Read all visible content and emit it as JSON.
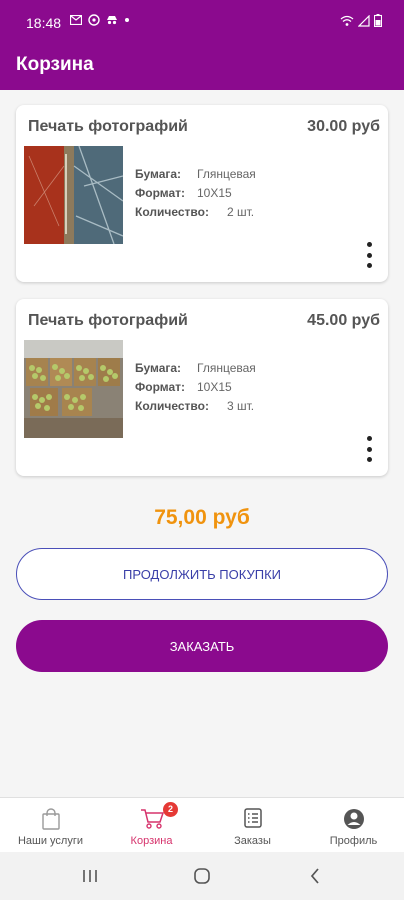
{
  "status_bar": {
    "time": "18:48"
  },
  "app_bar": {
    "title": "Корзина"
  },
  "cart": {
    "items": [
      {
        "service": "Печать фотографий",
        "price": "30.00 руб",
        "paper_label": "Бумага:",
        "paper_value": "Глянцевая",
        "format_label": "Формат:",
        "format_value": "10X15",
        "qty_label": "Количество:",
        "qty_value": "2 шт."
      },
      {
        "service": "Печать фотографий",
        "price": "45.00 руб",
        "paper_label": "Бумага:",
        "paper_value": "Глянцевая",
        "format_label": "Формат:",
        "format_value": "10X15",
        "qty_label": "Количество:",
        "qty_value": "3 шт."
      }
    ],
    "total": "75,00 руб"
  },
  "buttons": {
    "continue_shopping": "ПРОДОЛЖИТЬ ПОКУПКИ",
    "order": "ЗАКАЗАТЬ"
  },
  "bottom_nav": {
    "items": [
      {
        "label": "Наши услуги",
        "icon": "shopping-bag-icon"
      },
      {
        "label": "Корзина",
        "icon": "cart-icon",
        "badge": "2",
        "active": true
      },
      {
        "label": "Заказы",
        "icon": "list-icon"
      },
      {
        "label": "Профиль",
        "icon": "account-icon"
      }
    ]
  },
  "colors": {
    "primary": "#8b0a8e",
    "total": "#f0930e",
    "outline_button": "#3a3fa8",
    "active_nav": "#d6336c",
    "badge": "#e53935"
  }
}
